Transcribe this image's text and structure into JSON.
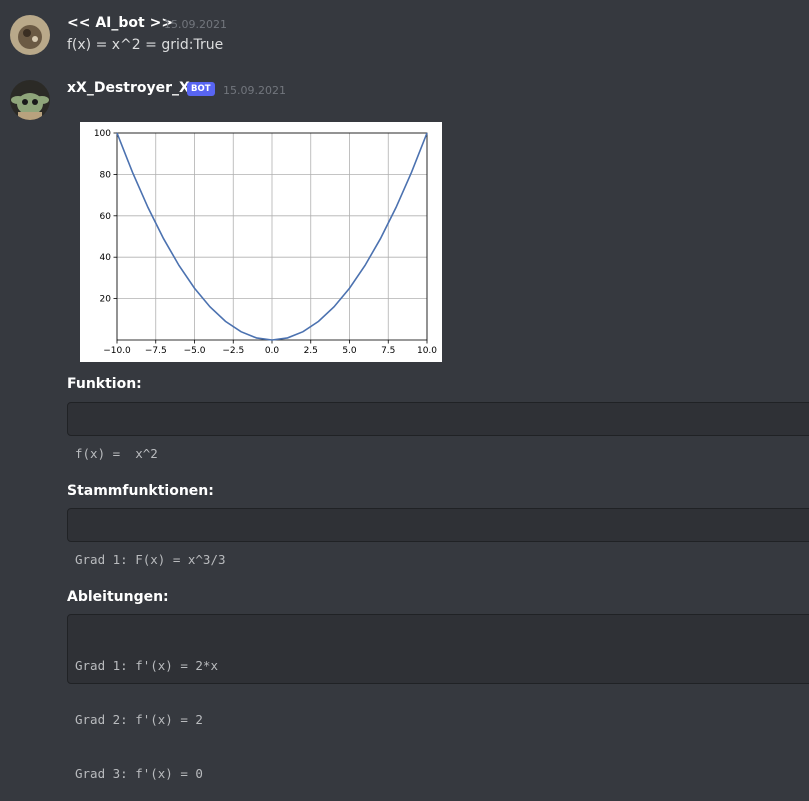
{
  "messages": [
    {
      "author": "<< AI_bot >>",
      "timestamp": "15.09.2021",
      "text": "f(x) = x^2 = grid:True"
    },
    {
      "author": "xX_Destroyer_Xx",
      "badge": "BOT",
      "timestamp": "15.09.2021"
    }
  ],
  "sections": {
    "funktion": {
      "title": "Funktion:",
      "lines": [
        "f(x) =  x^2"
      ]
    },
    "stamm": {
      "title": "Stammfunktionen:",
      "lines": [
        "Grad 1: F(x) = x^3/3"
      ]
    },
    "ableitungen": {
      "title": "Ableitungen:",
      "lines": [
        "Grad 1: f'(x) = 2*x",
        "Grad 2: f'(x) = 2",
        "Grad 3: f'(x) = 0"
      ]
    }
  },
  "chart_data": {
    "type": "line",
    "title": "",
    "xlabel": "",
    "ylabel": "",
    "xlim": [
      -10,
      10
    ],
    "ylim": [
      0,
      100
    ],
    "grid": true,
    "xticks": [
      -10.0,
      -7.5,
      -5.0,
      -2.5,
      0.0,
      2.5,
      5.0,
      7.5,
      10.0
    ],
    "xtick_labels": [
      "−10.0",
      "−7.5",
      "−5.0",
      "−2.5",
      "0.0",
      "2.5",
      "5.0",
      "7.5",
      "10.0"
    ],
    "yticks": [
      20,
      40,
      60,
      80,
      100
    ],
    "ytick_labels": [
      "20",
      "40",
      "60",
      "80",
      "100"
    ],
    "series": [
      {
        "color": "#4c72b0",
        "x": [
          -10,
          -9,
          -8,
          -7,
          -6,
          -5,
          -4,
          -3,
          -2,
          -1,
          0,
          1,
          2,
          3,
          4,
          5,
          6,
          7,
          8,
          9,
          10
        ],
        "y": [
          100,
          81,
          64,
          49,
          36,
          25,
          16,
          9,
          4,
          1,
          0,
          1,
          4,
          9,
          16,
          25,
          36,
          49,
          64,
          81,
          100
        ]
      }
    ]
  }
}
